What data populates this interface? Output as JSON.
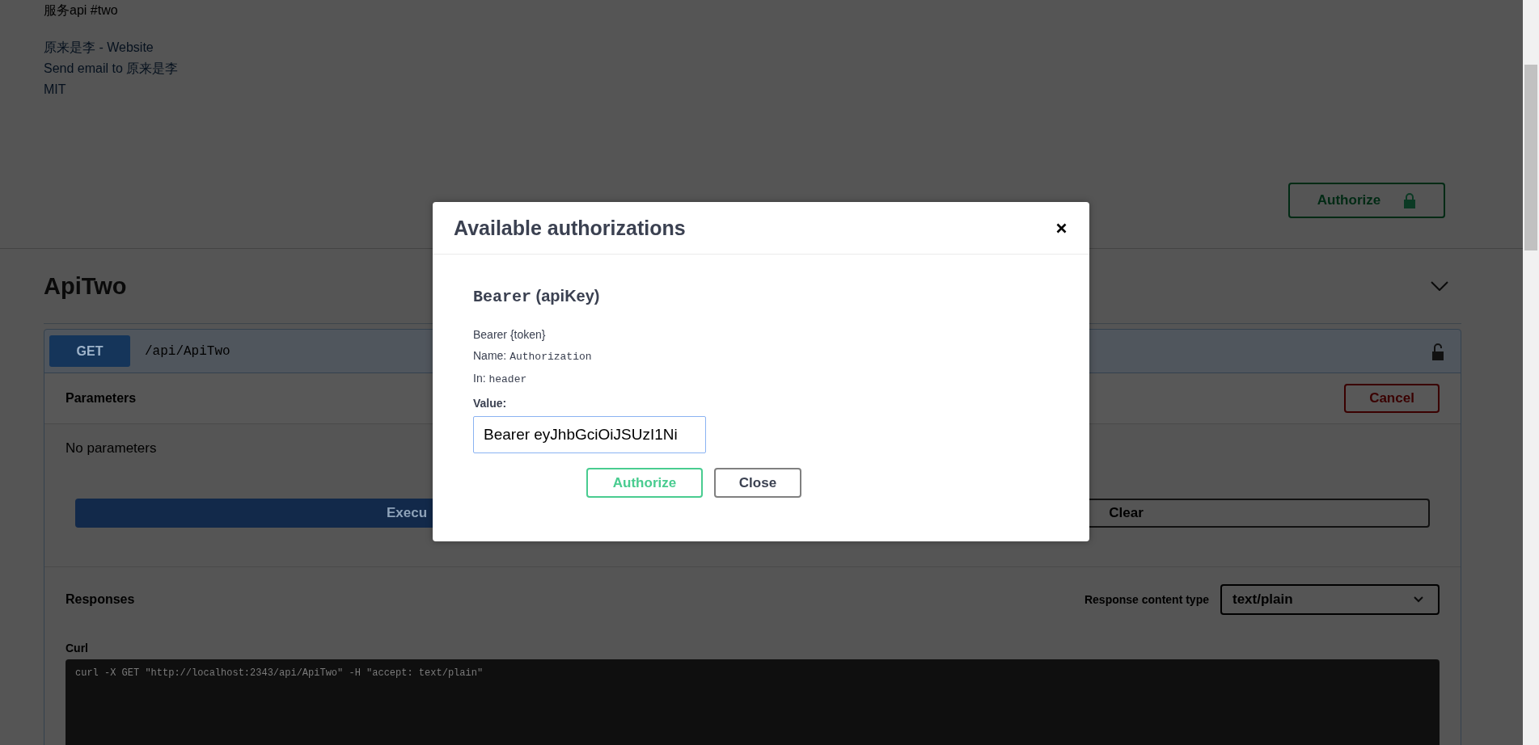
{
  "info": {
    "title": "服务api #two",
    "links": [
      {
        "text": "原来是李 - Website"
      },
      {
        "text": "Send email to 原来是李"
      },
      {
        "text": "MIT"
      }
    ]
  },
  "authorize_button": {
    "label": "Authorize"
  },
  "tag": {
    "name": "ApiTwo"
  },
  "operation": {
    "method": "GET",
    "path": "/api/ApiTwo",
    "parameters_title": "Parameters",
    "cancel_label": "Cancel",
    "no_parameters": "No parameters",
    "execute_label": "Execu",
    "clear_label": "Clear",
    "responses_title": "Responses",
    "content_type_label": "Response content type",
    "content_type": "text/plain",
    "curl_label": "Curl",
    "curl": "curl -X GET \"http://localhost:2343/api/ApiTwo\" -H \"accept: text/plain\""
  },
  "dialog": {
    "title": "Available authorizations",
    "scheme": {
      "name": "Bearer",
      "type": "(apiKey)",
      "description": "Bearer {token}",
      "name_label": "Name:",
      "name_value": "Authorization",
      "in_label": "In:",
      "in_value": "header",
      "value_label": "Value:",
      "value": "Bearer eyJhbGciOiJSUzI1Ni"
    },
    "buttons": [
      {
        "label": "Authorize",
        "kind": "primary"
      },
      {
        "label": "Close",
        "kind": "secondary"
      }
    ]
  }
}
